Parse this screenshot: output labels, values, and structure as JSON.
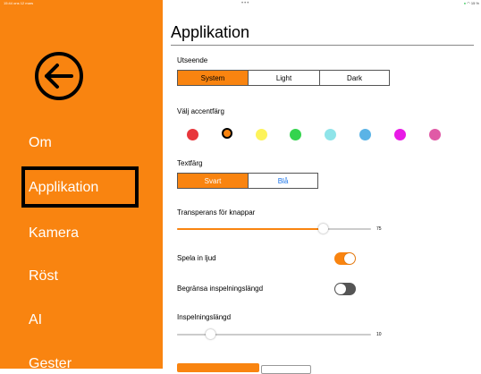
{
  "status_bar": {
    "time": "15:44",
    "date": "ons 12 mars",
    "dots": "•••",
    "battery": "15 %"
  },
  "sidebar": {
    "items": [
      {
        "label": "Om"
      },
      {
        "label": "Applikation"
      },
      {
        "label": "Kamera"
      },
      {
        "label": "Röst"
      },
      {
        "label": "AI"
      },
      {
        "label": "Gester"
      }
    ],
    "selected": "Applikation"
  },
  "main": {
    "title": "Applikation",
    "appearance": {
      "label": "Utseende",
      "options": [
        "System",
        "Light",
        "Dark"
      ],
      "selected": "System"
    },
    "accent": {
      "label": "Välj accentfärg",
      "colors": [
        "#e8363b",
        "#f98410",
        "#fdf35a",
        "#34d44e",
        "#8fe4e9",
        "#5ab3e6",
        "#e81ae6",
        "#e05aa6"
      ],
      "selected_index": 1
    },
    "text_color": {
      "label": "Textfärg",
      "options": [
        "Svart",
        "Blå"
      ],
      "selected": "Svart"
    },
    "transparency": {
      "label": "Transperans för knappar",
      "value": "75",
      "fraction": 0.75
    },
    "play_sound": {
      "label": "Spela in ljud",
      "on": true
    },
    "limit_recording": {
      "label": "Begränsa inspelningslängd",
      "on": false
    },
    "recording_length": {
      "label": "Inspelningslängd",
      "value": "10",
      "fraction": 0.17
    }
  },
  "colors": {
    "accent": "#f98410",
    "toggle_off": "#555555"
  }
}
